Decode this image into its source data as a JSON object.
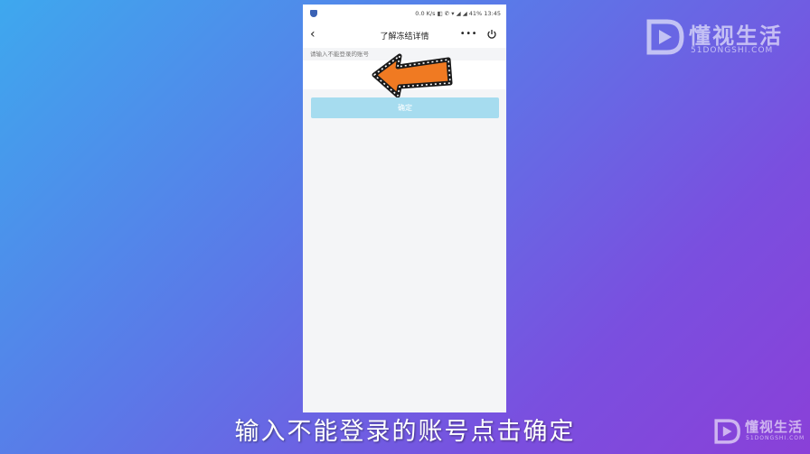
{
  "watermark": {
    "title": "懂视生活",
    "subtitle": "51DONGSHI.COM"
  },
  "status_bar": {
    "text": "0.0 K/s ◧ ✆ ▾ ◢ ◢ 41% 13:45"
  },
  "nav": {
    "title": "了解冻结详情",
    "more_icon": "more-dots-icon",
    "power_icon": "power-icon",
    "back_icon": "back-chevron-icon"
  },
  "form": {
    "label": "请输入不能登录的账号",
    "input_value": "",
    "confirm_label": "确定"
  },
  "annotation": {
    "arrow_color": "#f07a22"
  },
  "subtitle": "输入不能登录的账号点击确定"
}
